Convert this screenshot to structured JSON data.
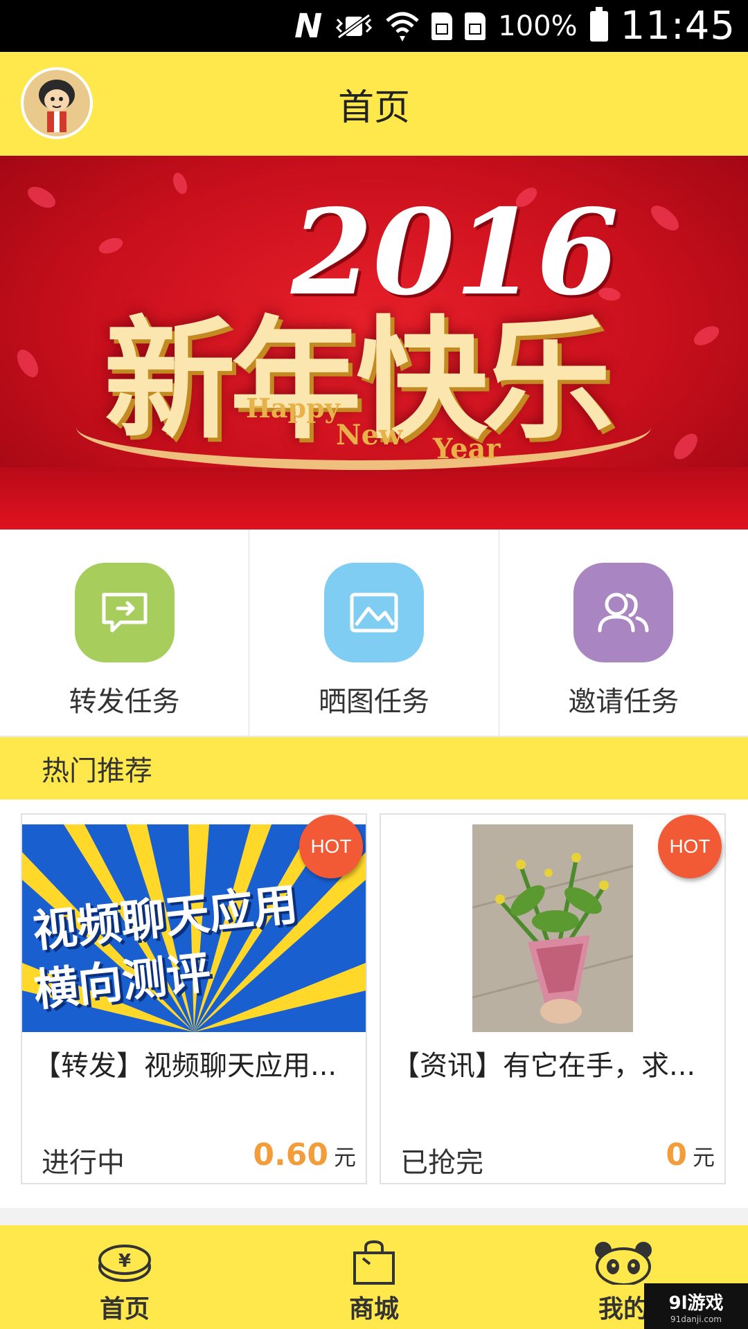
{
  "status_bar": {
    "battery": "100%",
    "time": "11:45",
    "icons": [
      "nfc-icon",
      "vibrate-icon",
      "wifi-icon",
      "sim1-icon",
      "sim2-icon",
      "battery-icon"
    ]
  },
  "header": {
    "title": "首页",
    "avatar": "avatar"
  },
  "banner": {
    "year": "2016",
    "headline": "新年快乐",
    "sub1": "Happy",
    "sub2": "New",
    "sub3": "Year"
  },
  "tasks": [
    {
      "label": "转发任务",
      "icon": "share-icon",
      "color": "#a7cd5c"
    },
    {
      "label": "晒图任务",
      "icon": "image-icon",
      "color": "#7fcdf2"
    },
    {
      "label": "邀请任务",
      "icon": "users-icon",
      "color": "#a986c2"
    }
  ],
  "section": {
    "title": "热门推荐"
  },
  "cards": [
    {
      "badge": "HOT",
      "image_text_line1": "视频聊天应用",
      "image_text_line2": "横向测评",
      "title": "【转发】视频聊天应用...",
      "status": "进行中",
      "price": "0.60",
      "unit": "元"
    },
    {
      "badge": "HOT",
      "title": "【资讯】有它在手，求...",
      "status": "已抢完",
      "price": "0",
      "unit": "元"
    }
  ],
  "bottom_nav": [
    {
      "label": "首页",
      "icon": "coin-icon"
    },
    {
      "label": "商城",
      "icon": "bag-icon"
    },
    {
      "label": "我的",
      "icon": "panda-icon"
    }
  ],
  "watermark": {
    "main": "9l游戏",
    "sub": "91danji.com"
  },
  "colors": {
    "accent_yellow": "#ffe84c",
    "price_orange": "#f39c3a",
    "hot_red": "#f25a36"
  }
}
